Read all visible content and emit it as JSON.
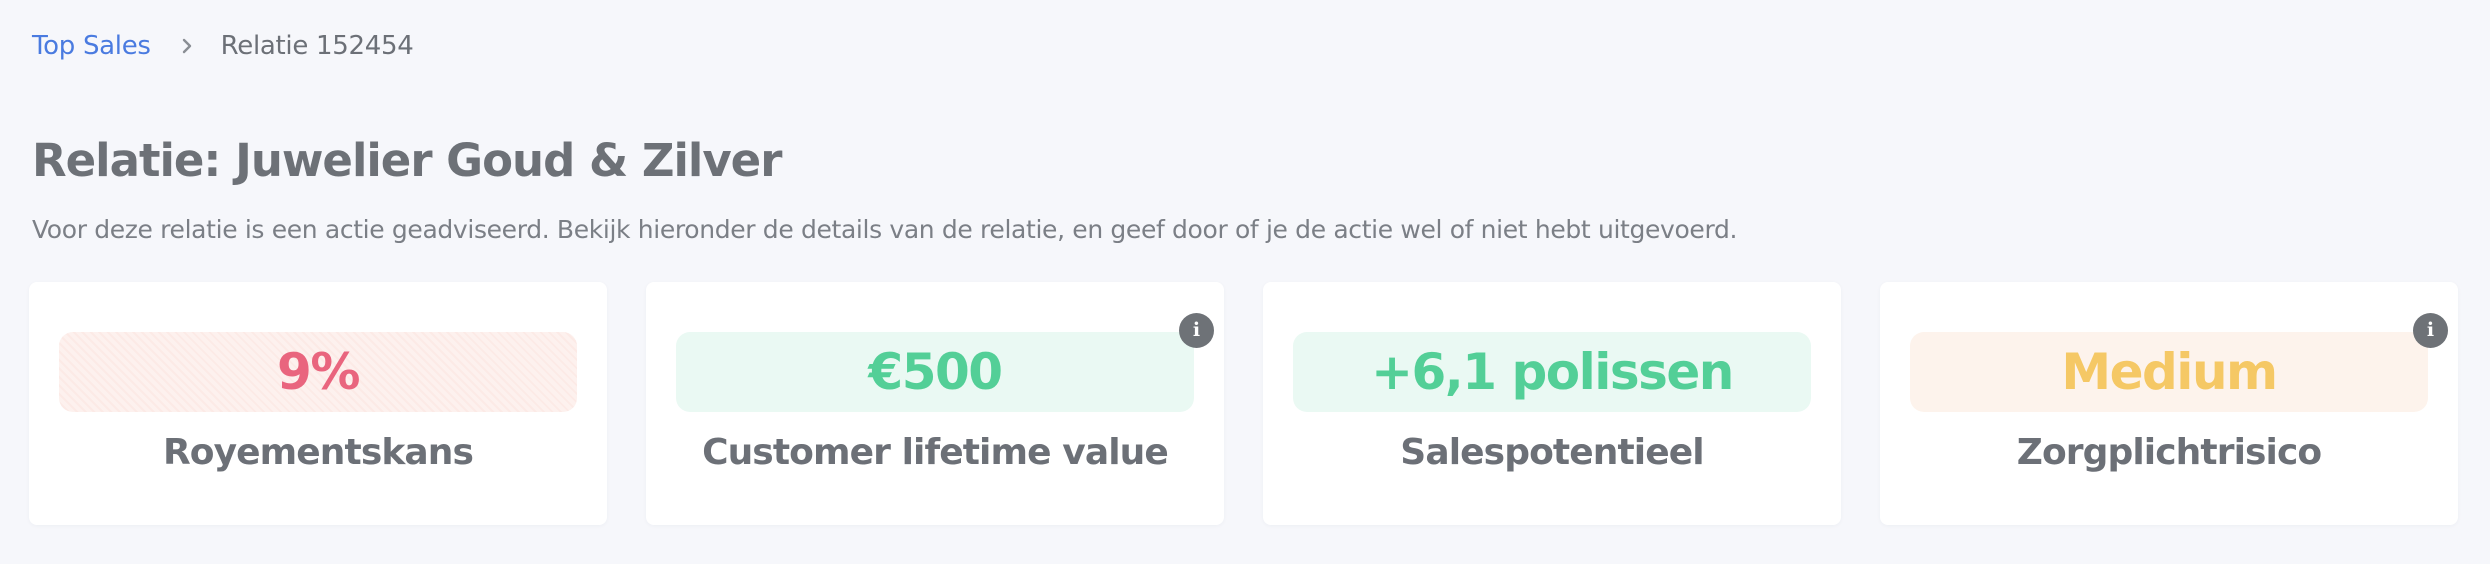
{
  "breadcrumb": {
    "items": [
      "Top Sales",
      "Relatie 152454"
    ],
    "separator_icon": "chevron-right-icon"
  },
  "page": {
    "title": "Relatie: Juwelier Goud & Zilver",
    "description": "Voor deze relatie is een actie geadviseerd. Bekijk hieronder de details van de relatie, en geef door of je de actie wel of niet hebt uitgevoerd."
  },
  "cards": [
    {
      "value": "9%",
      "label": "Royementskans",
      "info_icon": false,
      "value_color": "#e9657e",
      "background_color": "#fdf1ee"
    },
    {
      "value": "€500",
      "label": "Customer lifetime value",
      "info_icon": true,
      "info_glyph": "i",
      "value_color": "#53cf97",
      "background_color": "#eaf9f3"
    },
    {
      "value": "+6,1 polissen",
      "label": "Salespotentieel",
      "info_icon": false,
      "value_color": "#53cf97",
      "background_color": "#eaf9f3"
    },
    {
      "value": "Medium",
      "label": "Zorgplichtrisico",
      "info_icon": true,
      "info_glyph": "i",
      "value_color": "#f5c865",
      "background_color": "#fdf3ec"
    }
  ],
  "colors": {
    "link": "#4a7be0",
    "text": "#6c7077",
    "info_icon_bg": "#6e7277",
    "page_bg": "#f6f7fb"
  }
}
